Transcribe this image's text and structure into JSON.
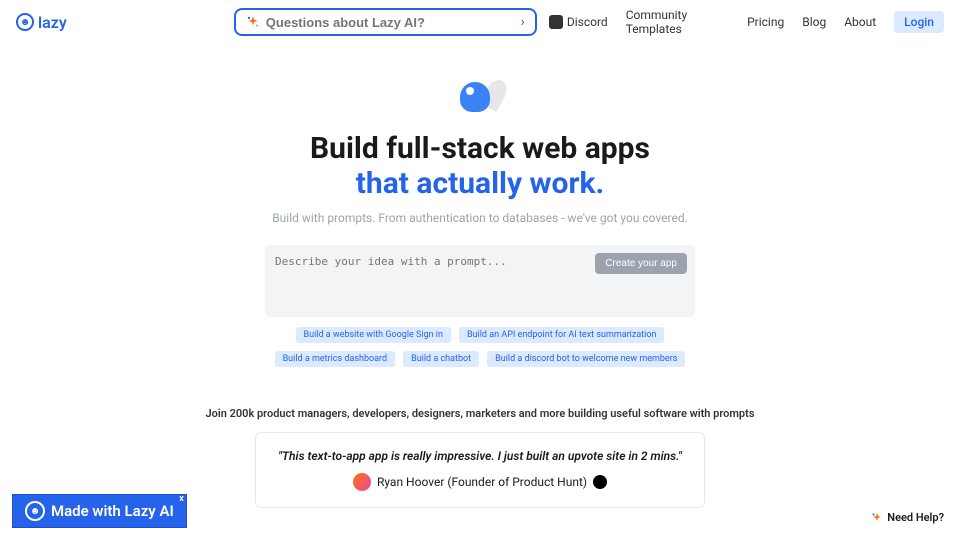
{
  "header": {
    "logo_text": "lazy",
    "search_placeholder": "Questions about Lazy AI?",
    "nav": {
      "discord": "Discord",
      "templates": "Community Templates",
      "pricing": "Pricing",
      "blog": "Blog",
      "about": "About",
      "login": "Login"
    }
  },
  "hero": {
    "title_line1": "Build full-stack web apps",
    "title_line2": "that actually work.",
    "subtitle": "Build with prompts. From authentication to databases - we've got you covered."
  },
  "prompt": {
    "placeholder": "Describe your idea with a prompt...",
    "button": "Create your app"
  },
  "chips": [
    "Build a website with Google Sign in",
    "Build an API endpoint for AI text summarization",
    "Build a metrics dashboard",
    "Build a chatbot",
    "Build a discord bot to welcome new members"
  ],
  "social_proof": "Join 200k product managers, developers, designers, marketers and more building useful software with prompts",
  "testimonial": {
    "quote": "\"This text-to-app app is really impressive. I just built an upvote site in 2 mins.\"",
    "author": "Ryan Hoover (Founder of Product Hunt)"
  },
  "made_with": "Made with Lazy AI",
  "need_help": "Need Help?"
}
